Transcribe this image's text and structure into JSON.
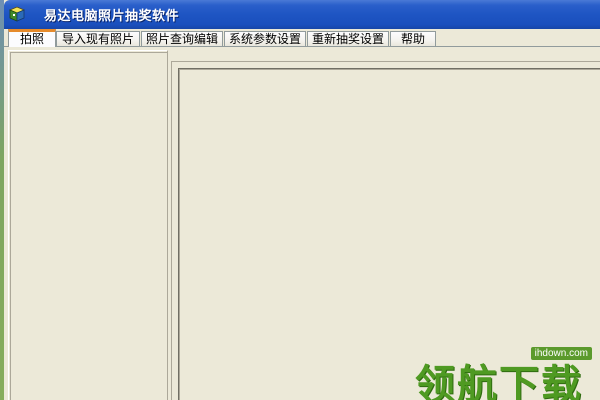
{
  "window": {
    "title": "易达电脑照片抽奖软件",
    "icon": "app-cube-icon"
  },
  "tabs": [
    {
      "label": "拍照",
      "active": true
    },
    {
      "label": "导入现有照片",
      "active": false
    },
    {
      "label": "照片查询编辑",
      "active": false
    },
    {
      "label": "系统参数设置",
      "active": false
    },
    {
      "label": "重新抽奖设置",
      "active": false
    },
    {
      "label": "帮助",
      "active": false
    }
  ],
  "watermark": {
    "url": "ihdown.com",
    "logo": "领航下载"
  },
  "colors": {
    "titlebar": "#1e55c3",
    "active_tab_accent": "#e68b2c",
    "face": "#ece9d8",
    "watermark": "#4f9a22"
  }
}
